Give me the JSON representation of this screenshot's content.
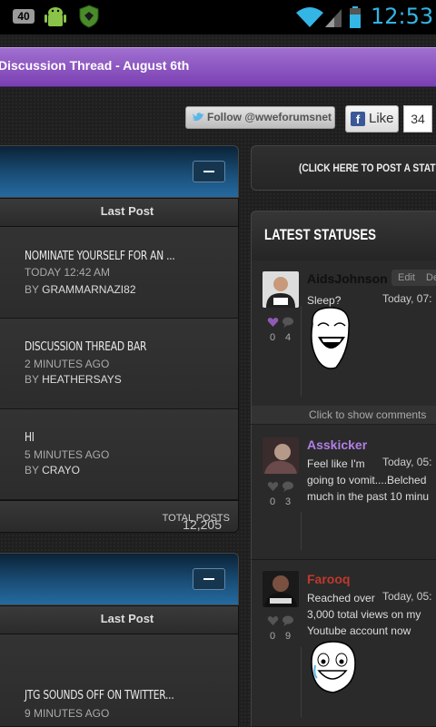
{
  "status_bar": {
    "badge": "40",
    "time": "12:53",
    "icons": [
      "android-icon",
      "shield-icon",
      "wifi-icon",
      "signal-icon",
      "battery-icon"
    ]
  },
  "thread_bar": {
    "title": "Discussion Thread - August 6th"
  },
  "social": {
    "follow_label": "Follow @wweforumsnet",
    "like_label": "Like",
    "like_count": "34"
  },
  "forum_section_1": {
    "last_post_header": "Last Post",
    "posts": [
      {
        "title": "Nominate yourself for an ...",
        "time": "Today 12:42 AM",
        "by_label": "BY",
        "author": "GrammarNazi82"
      },
      {
        "title": "Discussion Thread Bar",
        "time": "2 minutes ago",
        "by_label": "BY",
        "author": "HeatherSays"
      },
      {
        "title": "hi",
        "time": "5 minutes ago",
        "by_label": "BY",
        "author": "Crayo"
      }
    ],
    "total_posts_value": "12,205",
    "total_posts_label": "Total Posts"
  },
  "forum_section_2": {
    "last_post_header": "Last Post",
    "posts": [
      {
        "title": "JTG sounds off on Twitter...",
        "time": "9 minutes ago"
      }
    ]
  },
  "post_status_button": "(CLICK HERE TO POST A STATUS)",
  "latest_statuses": {
    "heading": "LATEST STATUSES",
    "show_comments": "Click to show comments",
    "items": [
      {
        "user": "AidsJohnson",
        "text": "Sleep?",
        "time": "Today, 07:",
        "likes": "0",
        "comments": "4",
        "edit": "Edit",
        "delete": "De"
      },
      {
        "user": "Asskicker",
        "text": "Feel like I'm",
        "text2": "going to vomit....Belched",
        "text3": "much in the past 10 minu",
        "time": "Today, 05:",
        "likes": "0",
        "comments": "3"
      },
      {
        "user": "Farooq",
        "text": "Reached over",
        "text2": "3,000 total views on my",
        "text3": "Youtube account now",
        "time": "Today, 05:",
        "likes": "0",
        "comments": "9"
      }
    ]
  },
  "colors": {
    "accent_blue": "#33b5e5",
    "thread_bar_purple": "#8a4fc2",
    "user_purple": "#b27ee6",
    "user_red": "#c0392b",
    "forum_header_blue": "#1a4e77"
  }
}
